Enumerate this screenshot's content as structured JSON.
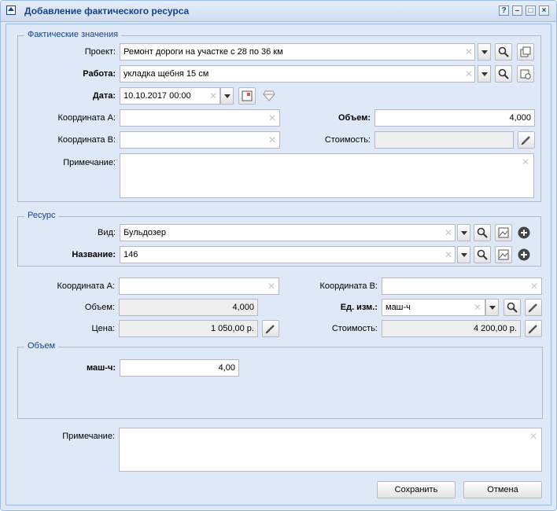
{
  "window": {
    "title": "Добавление фактического ресурса"
  },
  "fact": {
    "legend": "Фактические значения",
    "project_label": "Проект:",
    "project_value": "Ремонт дороги на участке с 28 по 36 км",
    "work_label": "Работа:",
    "work_value": "укладка щебня 15 см",
    "date_label": "Дата:",
    "date_value": "10.10.2017 00:00",
    "coordA_label": "Координата А:",
    "coordA_value": "",
    "coordB_label": "Координата В:",
    "coordB_value": "",
    "volume_label": "Объем:",
    "volume_value": "4,000",
    "cost_label": "Стоимость:",
    "cost_value": "",
    "note_label": "Примечание:",
    "note_value": ""
  },
  "resource": {
    "legend": "Ресурс",
    "kind_label": "Вид:",
    "kind_value": "Бульдозер",
    "name_label": "Название:",
    "name_value": "146"
  },
  "details": {
    "coordA_label": "Координата А:",
    "coordA_value": "",
    "coordB_label": "Координата В:",
    "coordB_value": "",
    "volume_label": "Объем:",
    "volume_value": "4,000",
    "unit_label": "Ед. изм.:",
    "unit_value": "маш-ч",
    "price_label": "Цена:",
    "price_value": "1 050,00 р.",
    "cost_label": "Стоимость:",
    "cost_value": "4 200,00 р."
  },
  "volume_group": {
    "legend": "Объем",
    "machine_label": "маш-ч:",
    "machine_value": "4,00"
  },
  "note": {
    "label": "Примечание:",
    "value": ""
  },
  "buttons": {
    "save": "Сохранить",
    "cancel": "Отмена"
  },
  "icons": [
    "window-icon",
    "help-icon",
    "minimize-icon",
    "maximize-icon",
    "close-icon",
    "search-icon",
    "stack-icon",
    "calendar-icon",
    "gem-icon",
    "edit-icon",
    "image-icon",
    "plus-icon",
    "clear-icon",
    "chevron-down-icon"
  ]
}
